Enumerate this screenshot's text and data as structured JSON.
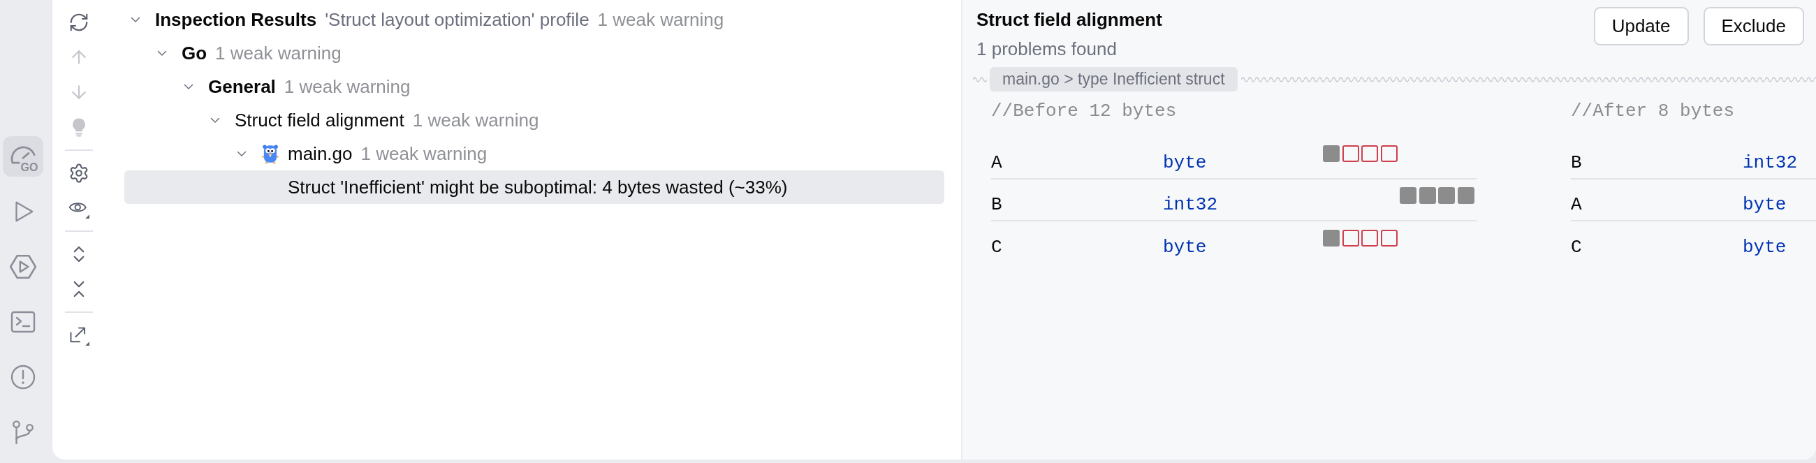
{
  "activity_bar": [
    {
      "kind": "profiler",
      "badge": "GO",
      "selected": true
    },
    {
      "kind": "run",
      "selected": false
    },
    {
      "kind": "services",
      "selected": false
    },
    {
      "kind": "terminal",
      "selected": false
    },
    {
      "kind": "problems",
      "selected": false
    },
    {
      "kind": "git",
      "selected": false
    }
  ],
  "toolbar": [
    {
      "kind": "refresh",
      "disabled": false
    },
    {
      "kind": "previous",
      "disabled": true
    },
    {
      "kind": "next",
      "disabled": true
    },
    {
      "kind": "quick_fix",
      "disabled": true
    },
    {
      "kind": "separator"
    },
    {
      "kind": "settings",
      "disabled": false
    },
    {
      "kind": "view_options",
      "disabled": false
    },
    {
      "kind": "separator"
    },
    {
      "kind": "expand_all",
      "disabled": false
    },
    {
      "kind": "collapse_all",
      "disabled": false
    },
    {
      "kind": "separator"
    },
    {
      "kind": "export",
      "disabled": false
    }
  ],
  "tree": {
    "kind": "root",
    "label": "Inspection Results",
    "detail": "'Struct layout optimization' profile",
    "count": "1 weak warning",
    "expanded": true,
    "selected": false,
    "children": [
      {
        "kind": "group",
        "label": "Go",
        "count": "1 weak warning",
        "expanded": true,
        "selected": false,
        "children": [
          {
            "kind": "group",
            "label": "General",
            "count": "1 weak warning",
            "expanded": true,
            "selected": false,
            "children": [
              {
                "kind": "inspection",
                "label": "Struct field alignment",
                "count": "1 weak warning",
                "expanded": true,
                "selected": false,
                "children": [
                  {
                    "kind": "file",
                    "label": "main.go",
                    "count": "1 weak warning",
                    "expanded": true,
                    "selected": false,
                    "children": [
                      {
                        "kind": "problem",
                        "label": "Struct 'Inefficient' might be suboptimal: 4 bytes wasted (~33%)",
                        "selected": true
                      }
                    ]
                  }
                ]
              }
            ]
          }
        ]
      }
    ]
  },
  "details": {
    "title": "Struct field alignment",
    "summary": "1 problems found",
    "buttons": [
      "Update",
      "Exclude"
    ],
    "breadcrumb": "main.go > type Inefficient struct",
    "layouts": [
      {
        "heading": "//Before 12 bytes",
        "fields": [
          {
            "name": "A",
            "type": "byte",
            "slots": [
              {
                "kind": "data"
              },
              {
                "kind": "padding"
              },
              {
                "kind": "padding"
              },
              {
                "kind": "padding"
              }
            ]
          },
          {
            "name": "B",
            "type": "int32",
            "slots": [
              {
                "kind": "empty"
              },
              {
                "kind": "empty"
              },
              {
                "kind": "empty"
              },
              {
                "kind": "empty"
              },
              {
                "kind": "data"
              },
              {
                "kind": "data"
              },
              {
                "kind": "data"
              },
              {
                "kind": "data"
              }
            ]
          },
          {
            "name": "C",
            "type": "byte",
            "slots": [
              {
                "kind": "data"
              },
              {
                "kind": "padding"
              },
              {
                "kind": "padding"
              },
              {
                "kind": "padding"
              }
            ]
          }
        ]
      },
      {
        "heading": "//After 8 bytes",
        "fields": [
          {
            "name": "B",
            "type": "int32"
          },
          {
            "name": "A",
            "type": "byte"
          },
          {
            "name": "C",
            "type": "byte"
          }
        ]
      }
    ]
  }
}
